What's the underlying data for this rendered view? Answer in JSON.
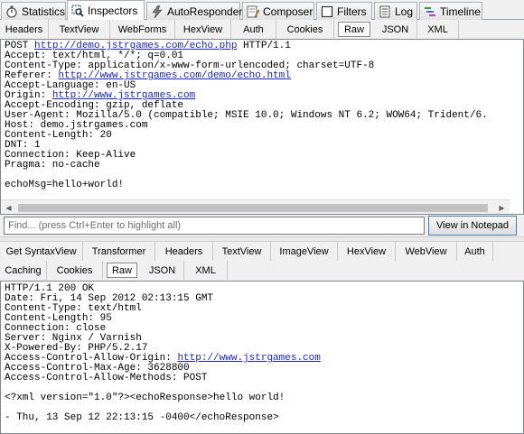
{
  "main_tabs": [
    {
      "label": "Statistics",
      "icon": "stopwatch-icon"
    },
    {
      "label": "Inspectors",
      "icon": "magnifier-icon"
    },
    {
      "label": "AutoResponder",
      "icon": "lightning-icon"
    },
    {
      "label": "Composer",
      "icon": "composer-icon"
    },
    {
      "label": "Filters",
      "icon": "checkbox-icon"
    },
    {
      "label": "Log",
      "icon": "log-icon"
    },
    {
      "label": "Timeline",
      "icon": "timeline-icon"
    }
  ],
  "request": {
    "tabs": [
      "Headers",
      "TextView",
      "WebForms",
      "HexView",
      "Auth",
      "Cookies",
      "Raw",
      "JSON",
      "XML"
    ],
    "active_tab": "Raw",
    "raw_lines": [
      {
        "text": "POST ",
        "link": "http://demo.jstrgames.com/echo.php",
        "after": " HTTP/1.1"
      },
      {
        "text": "Accept: text/html, */*; q=0.01"
      },
      {
        "text": "Content-Type: application/x-www-form-urlencoded; charset=UTF-8"
      },
      {
        "text": "Referer: ",
        "link": "http://www.jstrgames.com/demo/echo.html"
      },
      {
        "text": "Accept-Language: en-US"
      },
      {
        "text": "Origin: ",
        "link": "http://www.jstrgames.com"
      },
      {
        "text": "Accept-Encoding: gzip, deflate"
      },
      {
        "text": "User-Agent: Mozilla/5.0 (compatible; MSIE 10.0; Windows NT 6.2; WOW64; Trident/6."
      },
      {
        "text": "Host: demo.jstrgames.com"
      },
      {
        "text": "Content-Length: 20"
      },
      {
        "text": "DNT: 1"
      },
      {
        "text": "Connection: Keep-Alive"
      },
      {
        "text": "Pragma: no-cache"
      },
      {
        "text": ""
      },
      {
        "text": "echoMsg=hello+world!"
      }
    ],
    "find_placeholder": "Find... (press Ctrl+Enter to highlight all)",
    "view_notepad_label": "View in Notepad"
  },
  "response": {
    "tabs_row1": [
      "Get SyntaxView",
      "Transformer",
      "Headers",
      "TextView",
      "ImageView",
      "HexView",
      "WebView",
      "Auth"
    ],
    "tabs_row2": [
      "Caching",
      "Cookies",
      "Raw",
      "JSON",
      "XML"
    ],
    "active_tab": "Raw",
    "raw_lines": [
      {
        "text": "HTTP/1.1 200 OK"
      },
      {
        "text": "Date: Fri, 14 Sep 2012 02:13:15 GMT"
      },
      {
        "text": "Content-Type: text/html"
      },
      {
        "text": "Content-Length: 95"
      },
      {
        "text": "Connection: close"
      },
      {
        "text": "Server: Nginx / Varnish"
      },
      {
        "text": "X-Powered-By: PHP/5.2.17"
      },
      {
        "text": "Access-Control-Allow-Origin: ",
        "link": "http://www.jstrgames.com"
      },
      {
        "text": "Access-Control-Max-Age: 3628800"
      },
      {
        "text": "Access-Control-Allow-Methods: POST"
      },
      {
        "text": ""
      },
      {
        "text": "<?xml version=\"1.0\"?><echoResponse>hello world!"
      },
      {
        "text": ""
      },
      {
        "text": "- Thu, 13 Sep 12 22:13:15 -0400</echoResponse>"
      }
    ]
  }
}
